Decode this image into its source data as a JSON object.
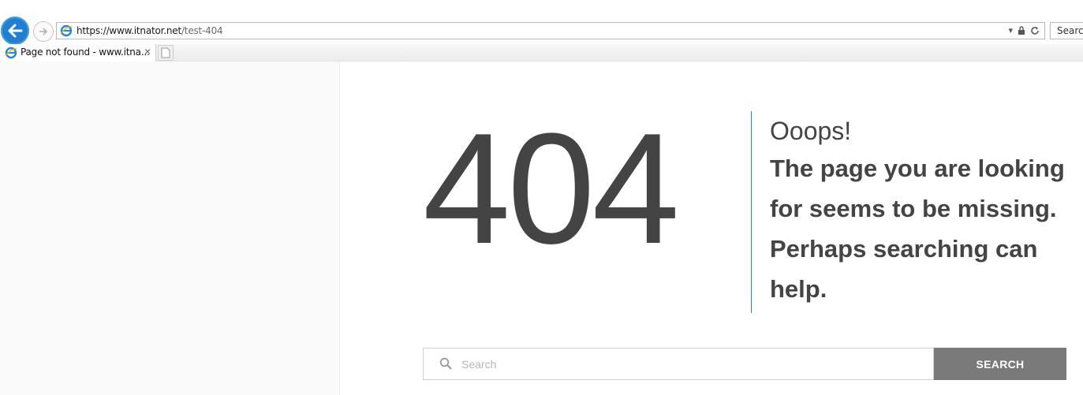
{
  "browser": {
    "url_host": "https://www.itnator.net",
    "url_path": "/test-404",
    "search_placeholder": "Search",
    "tab_title": "Page not found - www.itna...",
    "tab_close": "×"
  },
  "page": {
    "code": "404",
    "headline": "Ooops!",
    "message": "The page you are looking for seems to be missing. Perhaps searching can help.",
    "search_placeholder": "Search",
    "search_button": "SEARCH"
  },
  "colors": {
    "accent": "#2b7cd3",
    "text": "#444444",
    "button": "#7a7a7a",
    "back_button": "#1f7fd1"
  }
}
